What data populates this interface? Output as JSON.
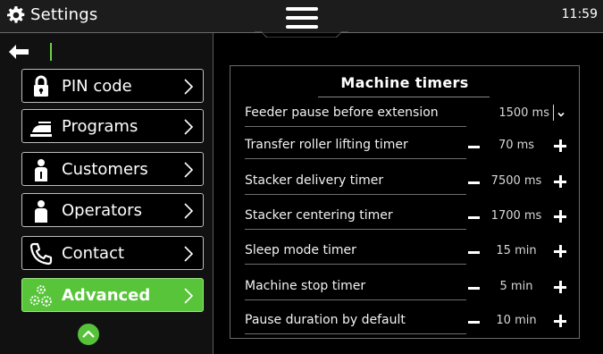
{
  "topbar": {
    "title": "Settings",
    "time": "11:59",
    "icons": {
      "settings": "gear-icon",
      "menu": "hamburger-menu-icon"
    }
  },
  "sidebar": {
    "back_icon": "arrow-left-icon",
    "items": [
      {
        "label": "PIN code",
        "icon": "lock-icon",
        "active": false
      },
      {
        "label": "Programs",
        "icon": "iron-icon",
        "active": false
      },
      {
        "label": "Customers",
        "icon": "customer-person-icon",
        "active": false
      },
      {
        "label": "Operators",
        "icon": "operator-person-icon",
        "active": false
      },
      {
        "label": "Contact",
        "icon": "phone-icon",
        "active": false
      },
      {
        "label": "Advanced",
        "icon": "gears-icon",
        "active": true
      }
    ],
    "scroll_icon": "chevron-up-icon"
  },
  "panel": {
    "title": "Machine timers",
    "rows": [
      {
        "name": "Feeder pause before extension",
        "value": "1500 ms",
        "control": "dropdown"
      },
      {
        "name": "Transfer roller lifting timer",
        "value": "70 ms",
        "control": "stepper"
      },
      {
        "name": "Stacker delivery timer",
        "value": "7500 ms",
        "control": "stepper"
      },
      {
        "name": "Stacker centering timer",
        "value": "1700 ms",
        "control": "stepper"
      },
      {
        "name": "Sleep mode  timer",
        "value": "15 min",
        "control": "stepper"
      },
      {
        "name": "Machine stop timer",
        "value": "5 min",
        "control": "stepper"
      },
      {
        "name": "Pause duration by default",
        "value": "10 min",
        "control": "stepper"
      }
    ]
  },
  "colors": {
    "accent_green": "#58c43a",
    "background": "#000000",
    "topbar": "#1c1c1c",
    "border": "#bdbdbd"
  }
}
